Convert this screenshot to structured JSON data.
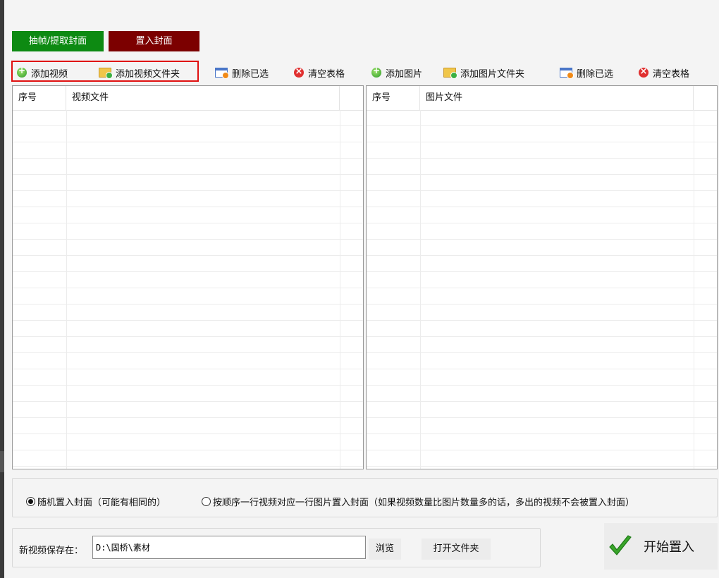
{
  "mode_tabs": {
    "extract": "抽帧/提取封面",
    "embed": "置入封面"
  },
  "video_toolbar": {
    "add_video": "添加视频",
    "add_video_folder": "添加视频文件夹",
    "delete_selected": "删除已选",
    "clear_table": "清空表格"
  },
  "image_toolbar": {
    "add_image": "添加图片",
    "add_image_folder": "添加图片文件夹",
    "delete_selected": "删除已选",
    "clear_table": "清空表格"
  },
  "video_table": {
    "col_index": "序号",
    "col_file": "视频文件",
    "rows": []
  },
  "image_table": {
    "col_index": "序号",
    "col_file": "图片文件",
    "rows": []
  },
  "options": {
    "random": "随机置入封面（可能有相同的）",
    "sequential": "按顺序一行视频对应一行图片置入封面（如果视频数量比图片数量多的话，多出的视频不会被置入封面）",
    "selected": "random"
  },
  "save": {
    "label": "新视频保存在：",
    "path": "D:\\固桥\\素材",
    "browse": "浏览",
    "open_folder": "打开文件夹"
  },
  "start_button": "开始置入",
  "colors": {
    "extract_tab": "#0d8a12",
    "embed_tab": "#7c0000",
    "highlight": "#e01010",
    "checkmark": "#3aa52a"
  }
}
